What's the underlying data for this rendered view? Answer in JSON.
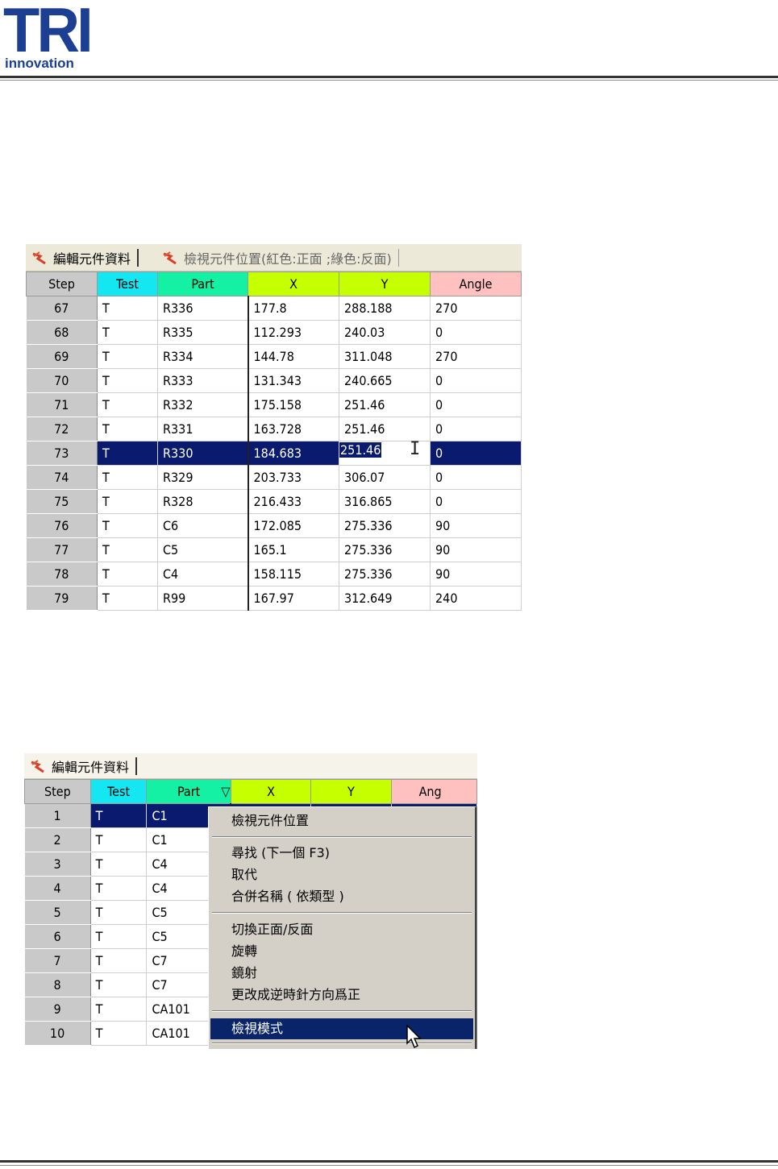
{
  "logo": {
    "mark": "TRI",
    "subtitle": "innovation"
  },
  "grid1": {
    "tabs": [
      {
        "label": "編輯元件資料"
      },
      {
        "label": "檢視元件位置(紅色:正面 ;綠色:反面)"
      }
    ],
    "columns": [
      "Step",
      "Test",
      "Part",
      "X",
      "Y",
      "Angle"
    ],
    "rows": [
      [
        "67",
        "T",
        "R336",
        "177.8",
        "288.188",
        "270"
      ],
      [
        "68",
        "T",
        "R335",
        "112.293",
        "240.03",
        "0"
      ],
      [
        "69",
        "T",
        "R334",
        "144.78",
        "311.048",
        "270"
      ],
      [
        "70",
        "T",
        "R333",
        "131.343",
        "240.665",
        "0"
      ],
      [
        "71",
        "T",
        "R332",
        "175.158",
        "251.46",
        "0"
      ],
      [
        "72",
        "T",
        "R331",
        "163.728",
        "251.46",
        "0"
      ],
      [
        "73",
        "T",
        "R330",
        "184.683",
        "251.46",
        "0"
      ],
      [
        "74",
        "T",
        "R329",
        "203.733",
        "306.07",
        "0"
      ],
      [
        "75",
        "T",
        "R328",
        "216.433",
        "316.865",
        "0"
      ],
      [
        "76",
        "T",
        "C6",
        "172.085",
        "275.336",
        "90"
      ],
      [
        "77",
        "T",
        "C5",
        "165.1",
        "275.336",
        "90"
      ],
      [
        "78",
        "T",
        "C4",
        "158.115",
        "275.336",
        "90"
      ],
      [
        "79",
        "T",
        "R99",
        "167.97",
        "312.649",
        "240"
      ]
    ],
    "selected_row": "73"
  },
  "grid2": {
    "tabs": [
      {
        "label": "編輯元件資料"
      }
    ],
    "columns": [
      "Step",
      "Test",
      "Part",
      "X",
      "Y",
      "Ang"
    ],
    "sort_indicator": "▽",
    "rows": [
      [
        "1",
        "T",
        "C1"
      ],
      [
        "2",
        "T",
        "C1"
      ],
      [
        "3",
        "T",
        "C4"
      ],
      [
        "4",
        "T",
        "C4"
      ],
      [
        "5",
        "T",
        "C5"
      ],
      [
        "6",
        "T",
        "C5"
      ],
      [
        "7",
        "T",
        "C7"
      ],
      [
        "8",
        "T",
        "C7"
      ],
      [
        "9",
        "T",
        "CA101"
      ],
      [
        "10",
        "T",
        "CA101"
      ]
    ],
    "selected_row": "1",
    "context_menu": {
      "view_position": "檢視元件位置",
      "find_next": "尋找 (下一個  F3)",
      "replace": "取代",
      "merge_names": "合併名稱 ( 依類型 )",
      "toggle_side": "切換正面/反面",
      "rotate": "旋轉",
      "mirror": "鏡射",
      "ccw_positive": "更改成逆時針方向爲正",
      "view_mode": "檢視模式"
    }
  },
  "colors": {
    "brand_blue": "#1c3f94",
    "selection": "#0a1a6e",
    "header_test": "#15e7f2",
    "header_part": "#14f0a4",
    "header_xy": "#c6ff00",
    "header_angle": "#ffc0c0"
  }
}
